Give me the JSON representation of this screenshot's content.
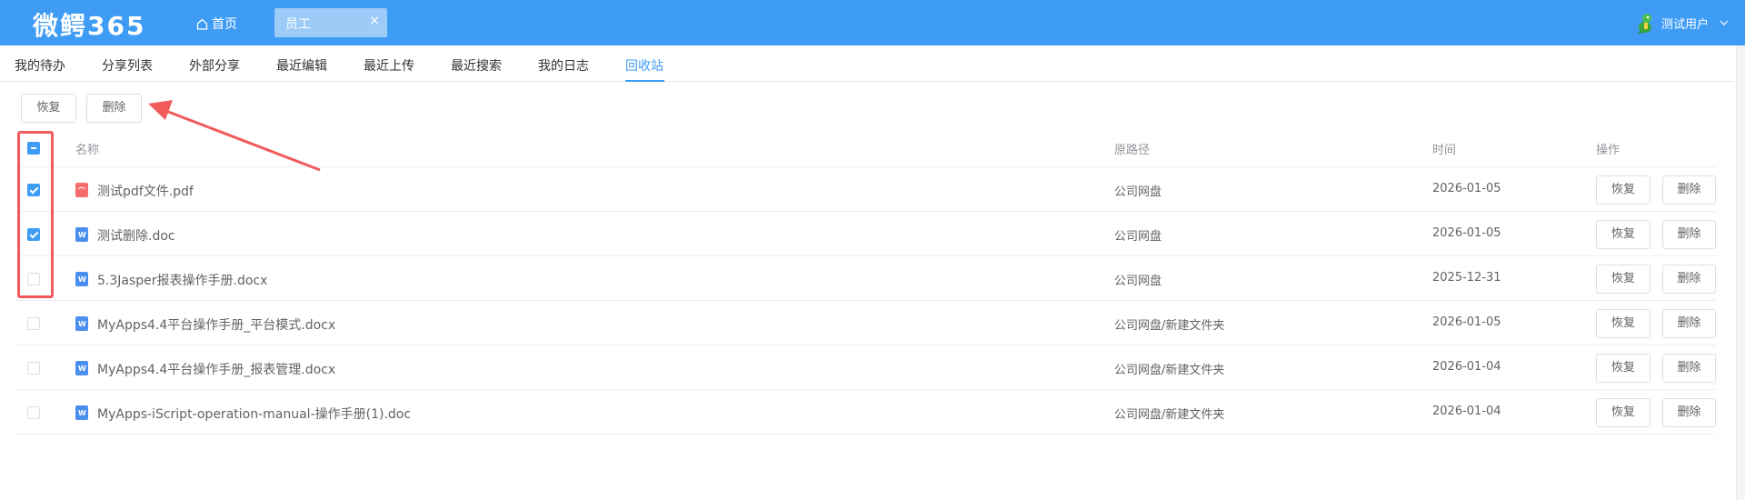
{
  "app": {
    "logo": "微鳄365",
    "home_label": "首页",
    "open_tab": "员工",
    "close_glyph": "×",
    "user_name": "测试用户"
  },
  "subnav": {
    "tabs": [
      "我的待办",
      "分享列表",
      "外部分享",
      "最近编辑",
      "最近上传",
      "最近搜索",
      "我的日志",
      "回收站"
    ],
    "active_index": 7
  },
  "toolbar": {
    "restore_label": "恢复",
    "delete_label": "删除"
  },
  "table": {
    "headers": {
      "name": "名称",
      "path": "原路径",
      "time": "时间",
      "actions": "操作"
    },
    "action_restore": "恢复",
    "action_delete": "删除",
    "rows": [
      {
        "name": "测试pdf文件.pdf",
        "type": "pdf",
        "path": "公司网盘",
        "time": "2026-01-05",
        "checked": true
      },
      {
        "name": "测试删除.doc",
        "type": "doc",
        "path": "公司网盘",
        "time": "2026-01-05",
        "checked": true
      },
      {
        "name": "5.3Jasper报表操作手册.docx",
        "type": "doc",
        "path": "公司网盘",
        "time": "2025-12-31",
        "checked": false
      },
      {
        "name": "MyApps4.4平台操作手册_平台模式.docx",
        "type": "doc",
        "path": "公司网盘/新建文件夹",
        "time": "2026-01-05",
        "checked": false
      },
      {
        "name": "MyApps4.4平台操作手册_报表管理.docx",
        "type": "doc",
        "path": "公司网盘/新建文件夹",
        "time": "2026-01-04",
        "checked": false
      },
      {
        "name": "MyApps-iScript-operation-manual-操作手册(1).doc",
        "type": "doc",
        "path": "公司网盘/新建文件夹",
        "time": "2026-01-04",
        "checked": false
      }
    ]
  },
  "colors": {
    "accent": "#3f9cf5",
    "annotation": "#f15b5b"
  }
}
